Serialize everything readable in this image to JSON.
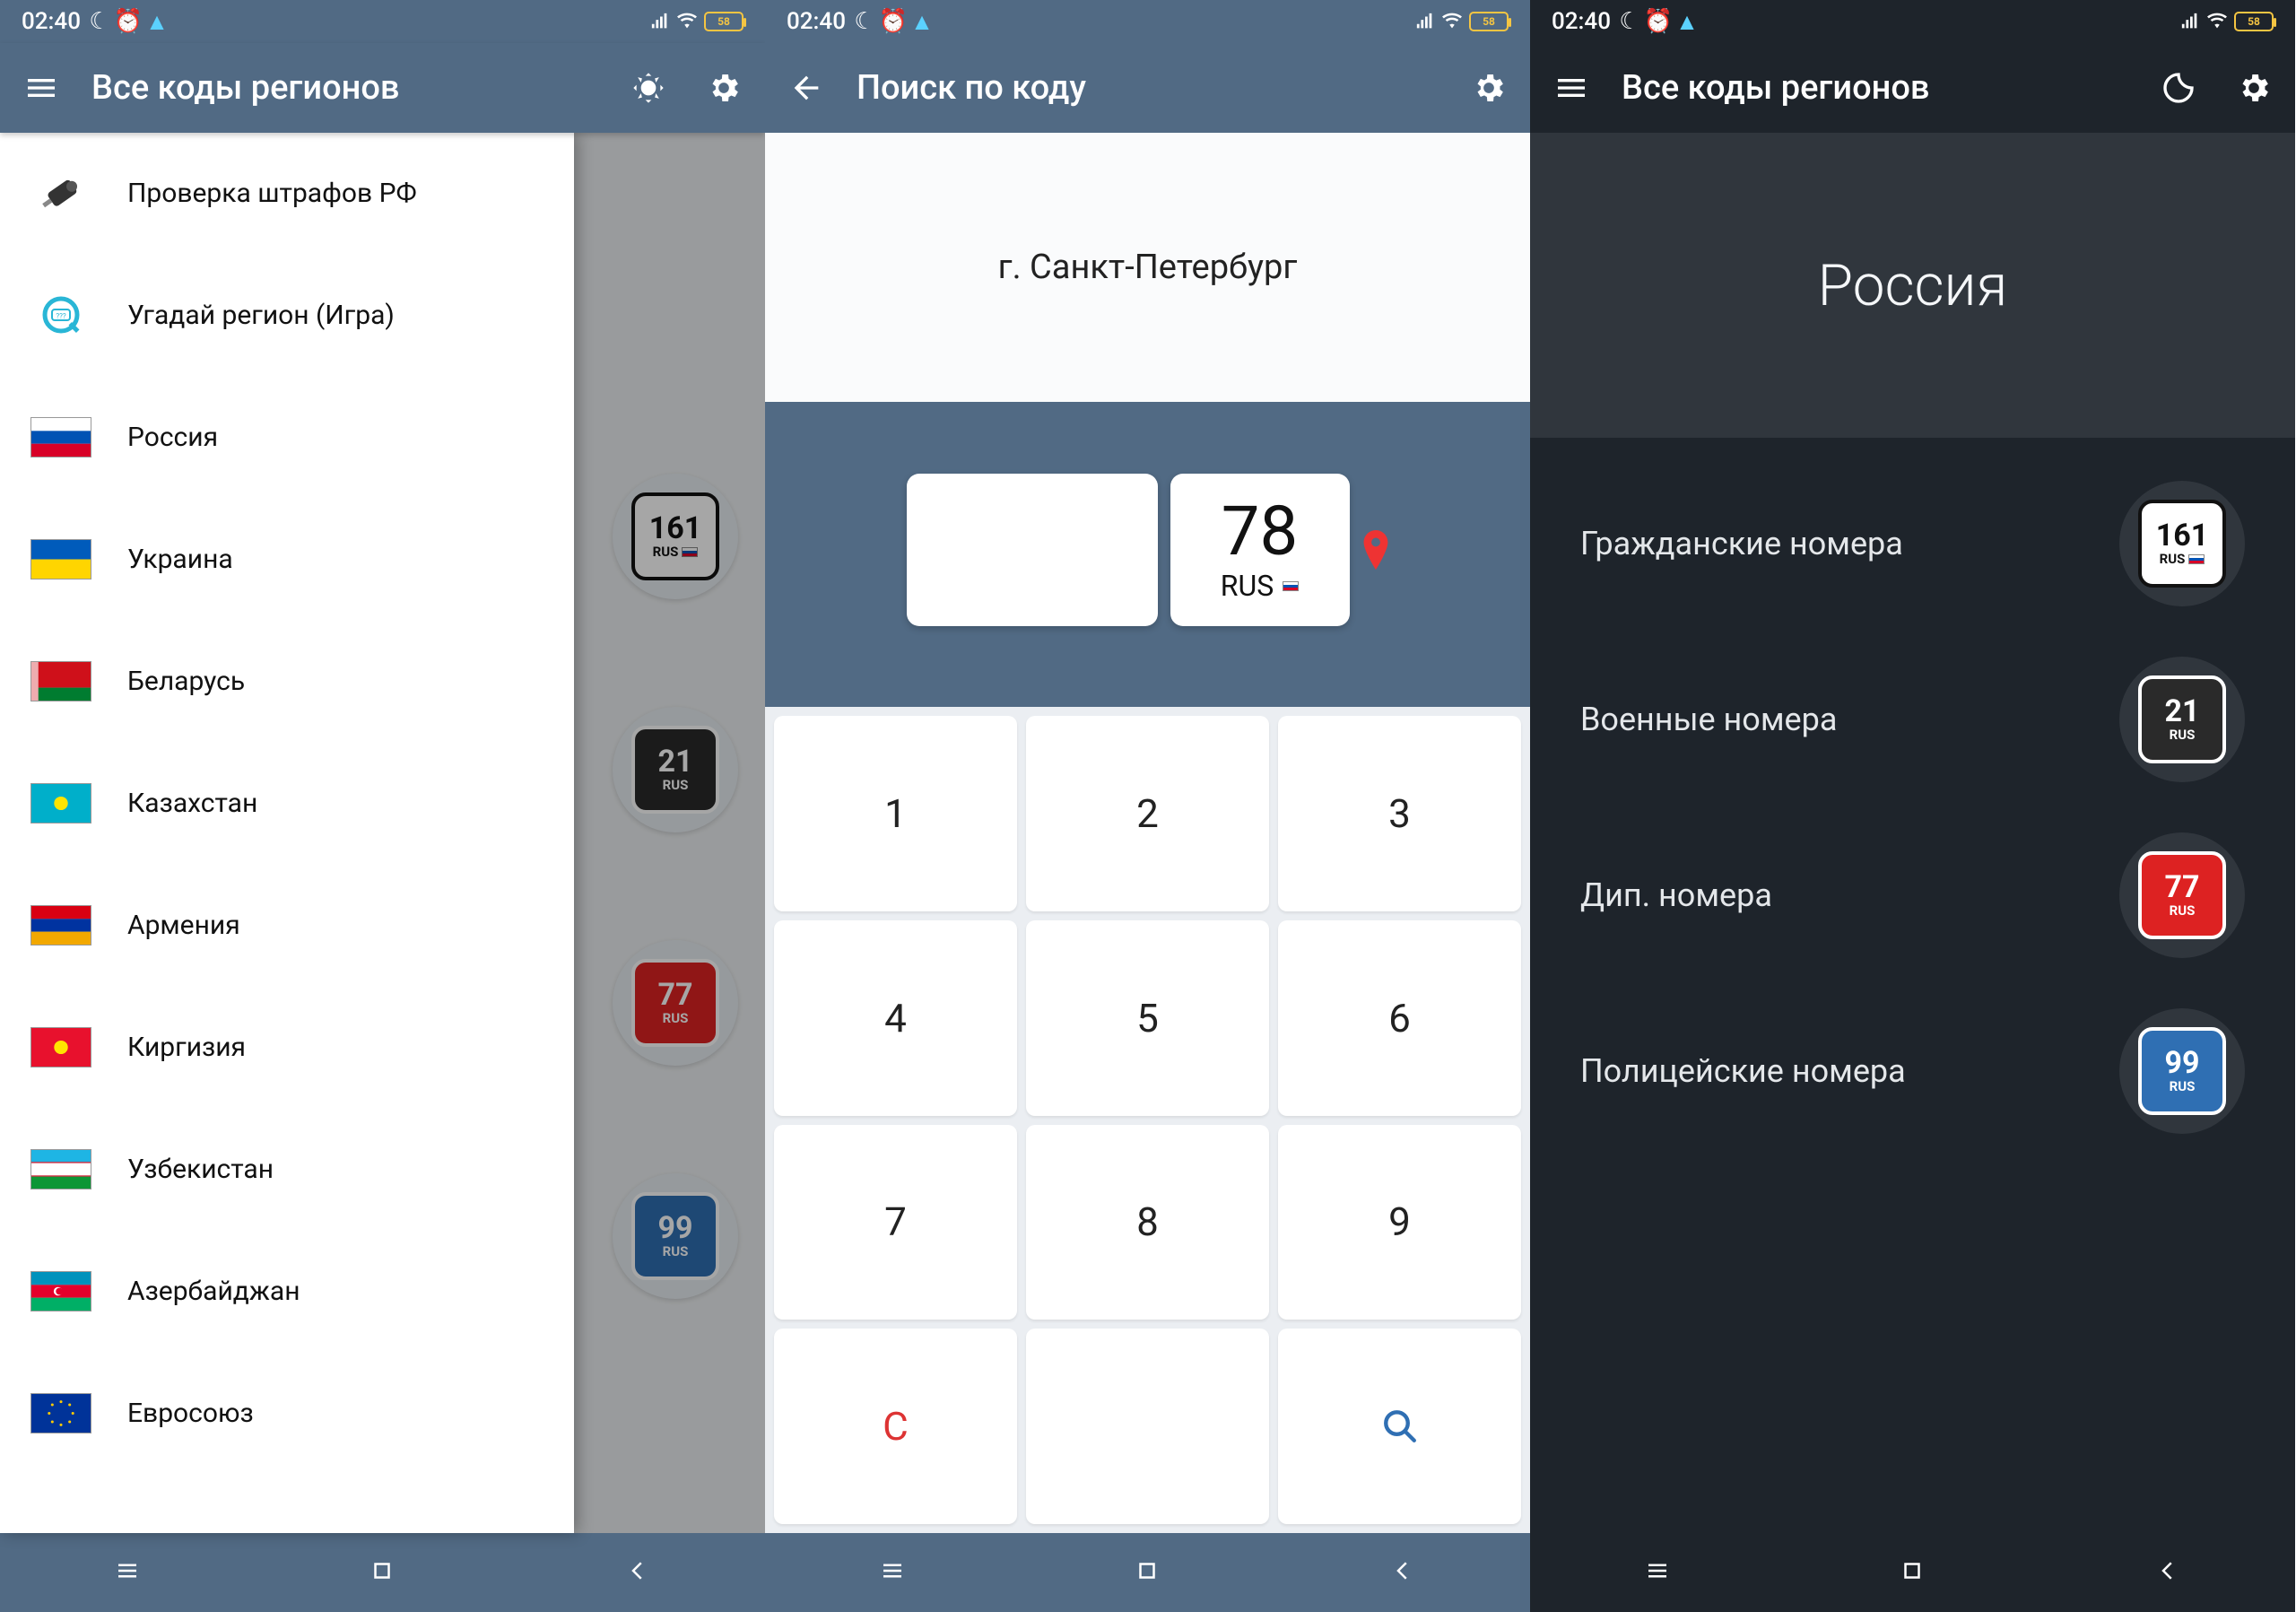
{
  "status": {
    "time": "02:40",
    "battery_text": "58"
  },
  "screen1": {
    "title": "Все коды регионов",
    "drawer": [
      {
        "label": "Проверка штрафов РФ"
      },
      {
        "label": "Угадай регион (Игра)"
      },
      {
        "label": "Россия"
      },
      {
        "label": "Украина"
      },
      {
        "label": "Беларусь"
      },
      {
        "label": "Казахстан"
      },
      {
        "label": "Армения"
      },
      {
        "label": "Киргизия"
      },
      {
        "label": "Узбекистан"
      },
      {
        "label": "Азербайджан"
      },
      {
        "label": "Евросоюз"
      }
    ],
    "peek_plates": [
      {
        "num": "161",
        "rus": "RUS",
        "style": "white"
      },
      {
        "num": "21",
        "rus": "RUS",
        "style": "dark"
      },
      {
        "num": "77",
        "rus": "RUS",
        "style": "red"
      },
      {
        "num": "99",
        "rus": "RUS",
        "style": "blue"
      }
    ]
  },
  "screen2": {
    "title": "Поиск по коду",
    "result": "г. Санкт-Петербург",
    "entered": "78",
    "rus": "RUS",
    "keys": [
      "1",
      "2",
      "3",
      "4",
      "5",
      "6",
      "7",
      "8",
      "9"
    ],
    "clear": "C"
  },
  "screen3": {
    "title": "Все коды регионов",
    "hero": "Россия",
    "rows": [
      {
        "label": "Гражданские номера",
        "plate_num": "161",
        "plate_style": "white"
      },
      {
        "label": "Военные номера",
        "plate_num": "21",
        "plate_style": "dark"
      },
      {
        "label": "Дип. номера",
        "plate_num": "77",
        "plate_style": "red"
      },
      {
        "label": "Полицейские номера",
        "plate_num": "99",
        "plate_style": "blue"
      }
    ],
    "rus": "RUS"
  }
}
